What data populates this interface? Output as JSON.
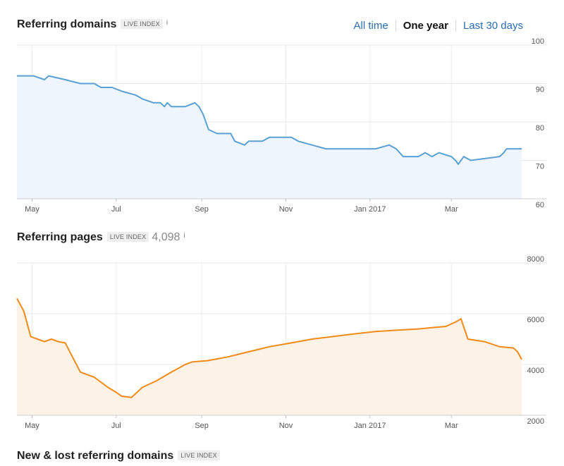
{
  "header": {
    "title": "Referring domains",
    "badge": "LIVE INDEX",
    "info": "i",
    "tabs": [
      {
        "label": "All time",
        "active": false
      },
      {
        "label": "One year",
        "active": true
      },
      {
        "label": "Last 30 days",
        "active": false
      }
    ]
  },
  "section2": {
    "title": "Referring pages",
    "badge": "LIVE INDEX",
    "count": "4,098",
    "info": "i"
  },
  "section3": {
    "title": "New & lost referring domains",
    "badge": "LIVE INDEX"
  },
  "colors": {
    "domains_line": "#5aa0d4",
    "domains_fill": "#eef5fc",
    "pages_line": "#ef8a17",
    "pages_fill": "#fdf2e6",
    "link": "#2a6cb0"
  },
  "chart_data": [
    {
      "type": "area",
      "x_tick_labels": [
        "May",
        "Jul",
        "Sep",
        "Nov",
        "Jan 2017",
        "Mar"
      ],
      "y_ticks": [
        60,
        70,
        80,
        90,
        100
      ],
      "ylim": [
        60,
        100
      ],
      "xlim": [
        "2016-04-20",
        "2017-04-21"
      ],
      "grid": true,
      "series": [
        {
          "x": [
            "2016-04-20",
            "2016-05-02",
            "2016-05-10",
            "2016-05-13",
            "2016-05-25",
            "2016-06-05",
            "2016-06-15",
            "2016-06-20",
            "2016-06-28",
            "2016-07-05",
            "2016-07-15",
            "2016-07-20",
            "2016-07-28",
            "2016-08-02",
            "2016-08-05",
            "2016-08-07",
            "2016-08-10",
            "2016-08-20",
            "2016-08-27",
            "2016-08-30",
            "2016-09-02",
            "2016-09-06",
            "2016-09-12",
            "2016-09-22",
            "2016-09-25",
            "2016-10-02",
            "2016-10-05",
            "2016-10-15",
            "2016-10-20",
            "2016-11-05",
            "2016-11-10",
            "2016-11-20",
            "2016-11-30",
            "2016-12-05",
            "2016-12-15",
            "2017-01-05",
            "2017-01-15",
            "2017-01-20",
            "2017-01-25",
            "2017-02-05",
            "2017-02-10",
            "2017-02-15",
            "2017-02-20",
            "2017-03-01",
            "2017-03-04",
            "2017-03-06",
            "2017-03-10",
            "2017-03-15",
            "2017-04-05",
            "2017-04-08",
            "2017-04-10",
            "2017-04-13",
            "2017-04-21"
          ],
          "y": [
            92,
            92,
            91,
            92,
            91,
            90,
            90,
            89,
            89,
            88,
            87,
            86,
            85,
            85,
            84,
            85,
            84,
            84,
            85,
            84,
            82,
            78,
            77,
            77,
            75,
            74,
            75,
            75,
            76,
            76,
            75,
            74,
            73,
            73,
            73,
            73,
            74,
            73,
            71,
            71,
            72,
            71,
            72,
            71,
            70,
            69,
            71,
            70,
            71,
            72,
            73,
            73,
            73
          ]
        }
      ]
    },
    {
      "type": "area",
      "x_tick_labels": [
        "May",
        "Jul",
        "Sep",
        "Nov",
        "Jan 2017",
        "Mar"
      ],
      "y_ticks": [
        2000,
        4000,
        6000,
        8000
      ],
      "ylim": [
        2000,
        8000
      ],
      "xlim": [
        "2016-04-20",
        "2017-04-21"
      ],
      "grid": true,
      "series": [
        {
          "x": [
            "2016-04-20",
            "2016-04-25",
            "2016-04-30",
            "2016-05-05",
            "2016-05-10",
            "2016-05-15",
            "2016-05-20",
            "2016-05-25",
            "2016-06-05",
            "2016-06-15",
            "2016-06-25",
            "2016-07-01",
            "2016-07-05",
            "2016-07-12",
            "2016-07-20",
            "2016-07-30",
            "2016-08-10",
            "2016-08-20",
            "2016-08-25",
            "2016-09-05",
            "2016-09-20",
            "2016-10-05",
            "2016-10-20",
            "2016-11-05",
            "2016-11-20",
            "2016-12-05",
            "2016-12-20",
            "2017-01-05",
            "2017-01-20",
            "2017-02-05",
            "2017-02-15",
            "2017-02-25",
            "2017-03-05",
            "2017-03-08",
            "2017-03-13",
            "2017-03-25",
            "2017-04-05",
            "2017-04-15",
            "2017-04-18",
            "2017-04-21"
          ],
          "y": [
            6600,
            6100,
            5100,
            5000,
            4900,
            5000,
            4900,
            4850,
            3700,
            3500,
            3100,
            2900,
            2750,
            2700,
            3100,
            3350,
            3700,
            4000,
            4100,
            4150,
            4300,
            4500,
            4700,
            4850,
            5000,
            5100,
            5200,
            5300,
            5350,
            5400,
            5450,
            5500,
            5700,
            5800,
            5000,
            4900,
            4700,
            4650,
            4500,
            4200
          ]
        }
      ]
    }
  ]
}
